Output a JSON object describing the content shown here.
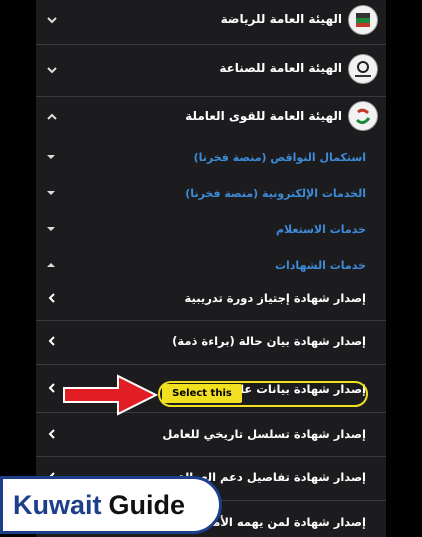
{
  "organizations": [
    {
      "label": "الهيئة العامة للرياضة",
      "icon": "sports-authority-logo-icon",
      "expanded": false
    },
    {
      "label": "الهيئة العامة للصناعة",
      "icon": "industry-authority-logo-icon",
      "expanded": false
    },
    {
      "label": "الهيئة العامة للقوى العاملة",
      "icon": "manpower-authority-logo-icon",
      "expanded": true
    }
  ],
  "manpower_submenu": [
    {
      "label": "استكمال النواقص (منصة فخرنا)",
      "expanded": false
    },
    {
      "label": "الخدمات الإلكترونية (منصة فخرنا)",
      "expanded": false
    },
    {
      "label": "خدمات الاستعلام",
      "expanded": false
    },
    {
      "label": "خدمات الشهادات",
      "expanded": true
    }
  ],
  "certificates": [
    "إصدار شهادة إجتياز دورة تدريبية",
    "إصدار شهادة بيان حالة (براءة ذمة)",
    "إصدار شهادة بيانات عامل",
    "إصدار شهادة تسلسل تاريخي للعامل",
    "إصدار شهادة تفاصيل دعم العمالة",
    "إصدار شهادة لمن يهمه الأمر(باب خ"
  ],
  "annotation": {
    "label": "Select this",
    "color": "#f0e020",
    "arrow_color": "#e01e24"
  },
  "watermark": {
    "part1": "Kuwait",
    "part2": "Guide"
  },
  "colors": {
    "link_blue": "#3d8bd9",
    "panel_bg": "#1c1c1f",
    "brand_blue": "#1d3f8a"
  }
}
